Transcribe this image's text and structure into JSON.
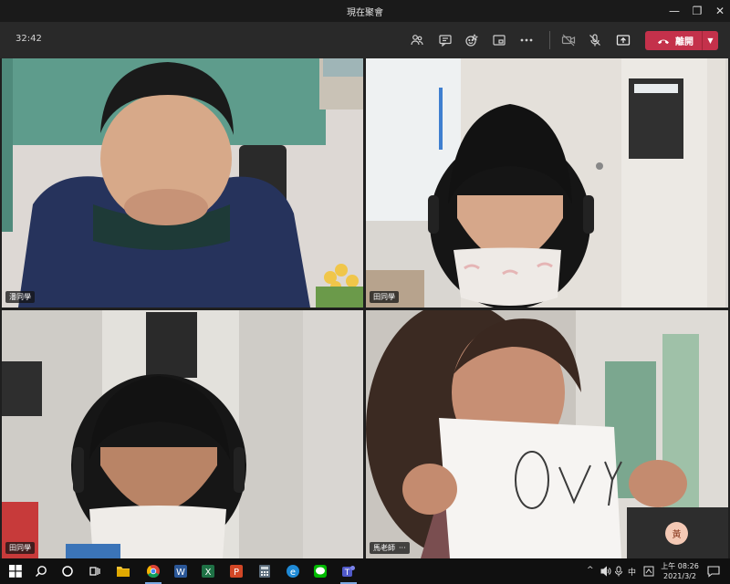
{
  "window": {
    "title": "現在聚會",
    "minimize_glyph": "—",
    "maximize_glyph": "❐",
    "close_glyph": "✕"
  },
  "toolbar": {
    "elapsed_time": "32:42",
    "buttons": [
      {
        "name": "participants-icon"
      },
      {
        "name": "chat-icon"
      },
      {
        "name": "reactions-icon"
      },
      {
        "name": "breakout-rooms-icon"
      },
      {
        "name": "more-actions-icon"
      },
      {
        "name": "camera-off-icon"
      },
      {
        "name": "mic-off-icon"
      },
      {
        "name": "share-screen-icon"
      }
    ],
    "leave_label": "離開",
    "leave_color": "#c4314b"
  },
  "participants": [
    {
      "name": "潘同學"
    },
    {
      "name": "田同學"
    },
    {
      "name": "田同學"
    },
    {
      "name": "馬老師",
      "more": "···"
    }
  ],
  "self_view": {
    "avatar_initial": "黃",
    "avatar_color": "#f4c9b5"
  },
  "taskbar": {
    "apps": [
      "windows-start-icon",
      "search-icon",
      "cortana-icon",
      "task-view-icon",
      "file-explorer-icon",
      "chrome-icon",
      "word-icon",
      "excel-icon",
      "powerpoint-icon",
      "calculator-icon",
      "edge-icon",
      "line-icon",
      "teams-icon"
    ],
    "tray_chevron": "^",
    "ime": "中",
    "clock_time": "上午 08:26",
    "clock_date": "2021/3/2"
  }
}
